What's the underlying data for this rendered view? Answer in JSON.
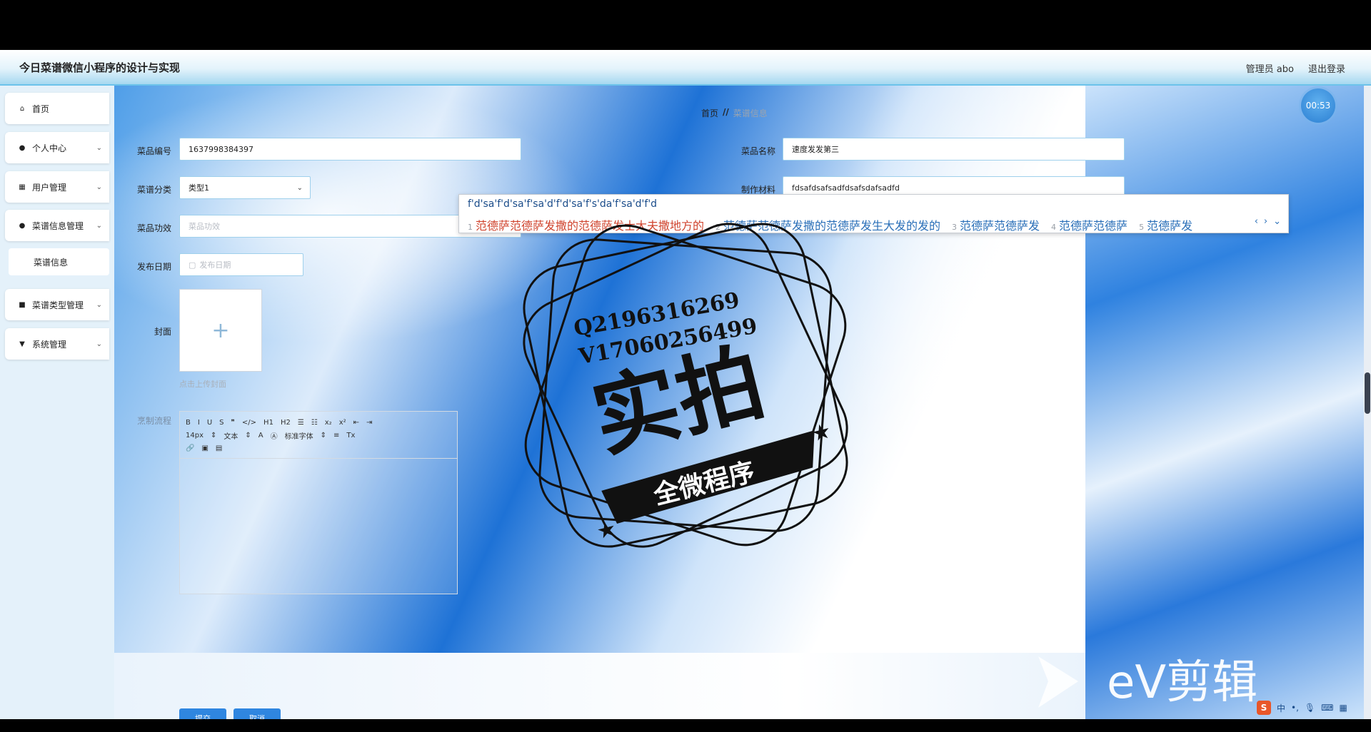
{
  "app": {
    "title": "今日菜谱微信小程序的设计与实现"
  },
  "header": {
    "user_label": "管理员 abo",
    "logout_label": "退出登录"
  },
  "sidebar": {
    "items": [
      {
        "label": "首页",
        "icon": "home-icon"
      },
      {
        "label": "个人中心",
        "icon": "user-icon"
      },
      {
        "label": "用户管理",
        "icon": "grid-icon"
      },
      {
        "label": "菜谱信息管理",
        "icon": "pin-icon"
      },
      {
        "label": "菜谱类型管理",
        "icon": "checkbox-icon"
      },
      {
        "label": "系统管理",
        "icon": "settings-icon"
      }
    ],
    "sub_item": "菜谱信息"
  },
  "breadcrumb": {
    "home": "首页",
    "sep": "//",
    "current": "菜谱信息"
  },
  "form": {
    "code_label": "菜品编号",
    "code_value": "1637998384397",
    "name_label": "菜品名称",
    "name_value": "速度发发第三",
    "category_label": "菜谱分类",
    "category_value": "类型1",
    "material_label": "制作材料",
    "material_value": "fdsafdsafsadfdsafsdafsadfd",
    "effect_label": "菜品功效",
    "effect_placeholder": "菜品功效",
    "date_label": "发布日期",
    "date_placeholder": "发布日期",
    "cover_label": "封面",
    "cover_hint": "点击上传封面",
    "process_label": "烹制流程",
    "submit_label": "提交",
    "cancel_label": "取消"
  },
  "editor": {
    "row1": [
      "B",
      "I",
      "U",
      "S",
      "❞",
      "</>",
      "H1",
      "H2",
      "☰",
      "☷",
      "x₂",
      "x²",
      "⇤",
      "⇥"
    ],
    "font_size": "14px",
    "text_style": "文本",
    "font_family": "标准字体"
  },
  "timer": "00:53",
  "ime": {
    "composition": "f'd'sa'f'd'sa'f'sa'd'f'd'sa'f's'da'f'sa'd'f'd",
    "candidates": [
      {
        "n": "1",
        "text": "范德萨范德萨发撒的范德萨发士大夫撒地方的"
      },
      {
        "n": "2",
        "text": "范德萨范德萨发撒的范德萨发生大发的发的"
      },
      {
        "n": "3",
        "text": "范德萨范德萨发"
      },
      {
        "n": "4",
        "text": "范德萨范德萨"
      },
      {
        "n": "5",
        "text": "范德萨发"
      }
    ]
  },
  "watermark": {
    "line1": "Q2196316269",
    "line2": "V17060256499",
    "big": "实拍",
    "banner": "全微程序"
  },
  "ev_logo": "eV剪辑",
  "tray": {
    "lang": "中"
  }
}
